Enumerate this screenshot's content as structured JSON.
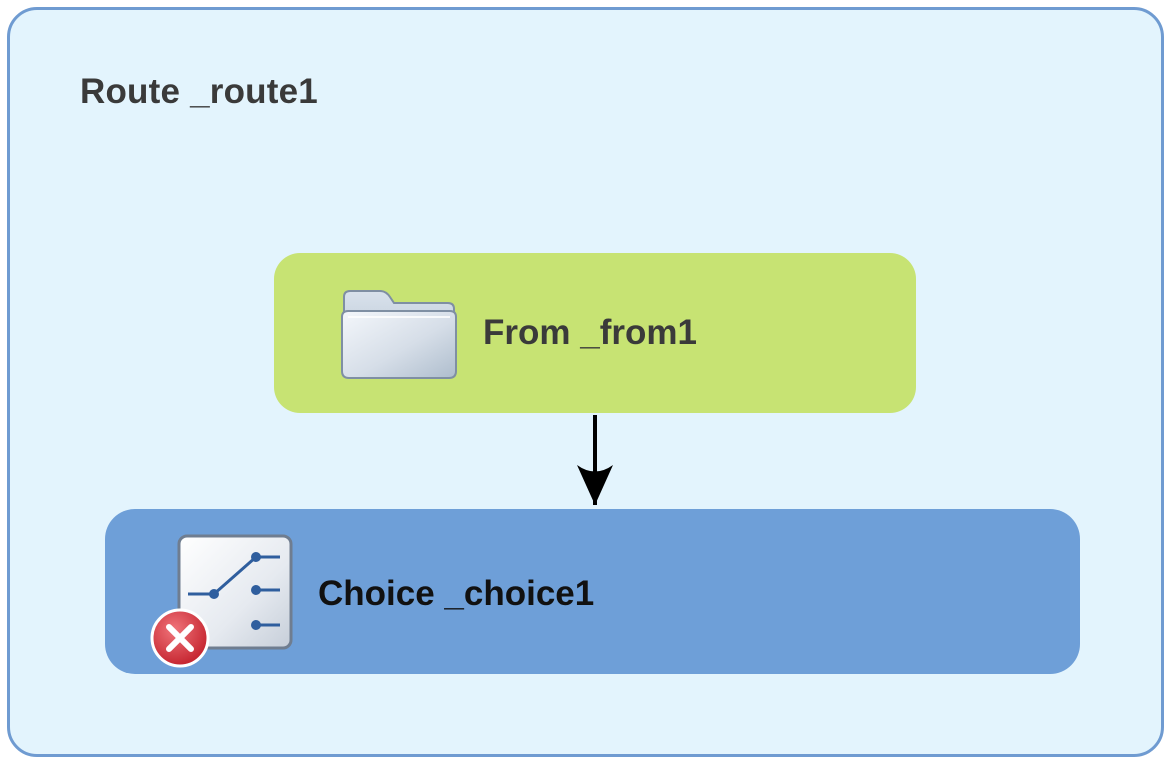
{
  "route": {
    "title": "Route _route1"
  },
  "nodes": {
    "from": {
      "label": "From _from1",
      "icon": "folder-icon",
      "color": "#c7e373"
    },
    "choice": {
      "label": "Choice _choice1",
      "icon": "choice-switch-icon",
      "status_icon": "error-icon",
      "color": "#6e9fd8"
    }
  },
  "colors": {
    "canvas_background": "#e3f4fd",
    "canvas_border": "#6f9bd1",
    "error": "#d9363e"
  }
}
